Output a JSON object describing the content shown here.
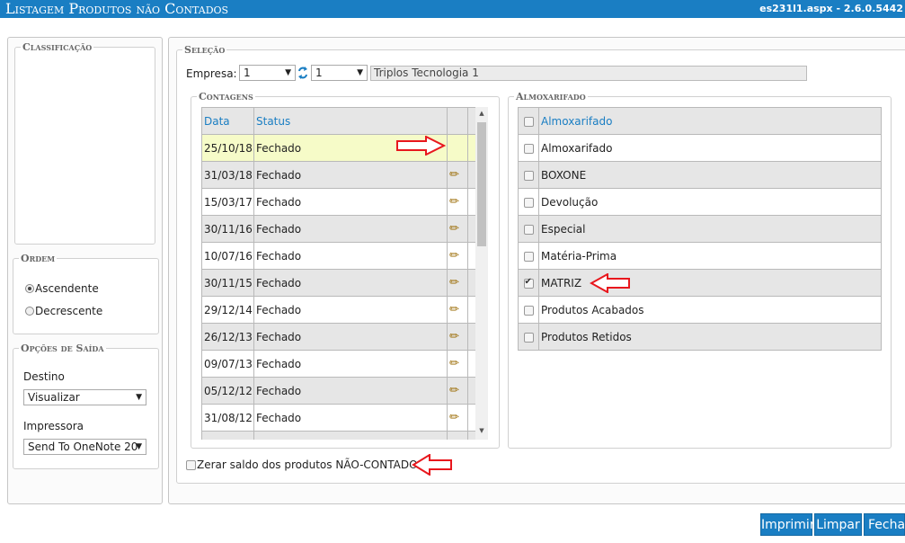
{
  "titlebar": {
    "title": "Listagem Produtos não Contados",
    "version": "es231l1.aspx - 2.6.0.5442"
  },
  "classificacao": {
    "legend": "Classificação"
  },
  "ordem": {
    "legend": "Ordem",
    "options": [
      "Ascendente",
      "Decrescente"
    ],
    "selected": "Ascendente"
  },
  "saida": {
    "legend": "Opções de Saída",
    "destino_label": "Destino",
    "destino_value": "Visualizar",
    "impressora_label": "Impressora",
    "impressora_value": "Send To OneNote 20"
  },
  "selecao": {
    "legend": "Seleção",
    "empresa_label": "Empresa:",
    "empresa_value": "1",
    "filial_value": "1",
    "empresa_nome": "Triplos Tecnologia 1"
  },
  "contagens": {
    "legend": "Contagens",
    "columns": [
      "Data",
      "Status"
    ],
    "rows": [
      {
        "data": "25/10/18",
        "status": "Fechado"
      },
      {
        "data": "31/03/18",
        "status": "Fechado"
      },
      {
        "data": "15/03/17",
        "status": "Fechado"
      },
      {
        "data": "30/11/16",
        "status": "Fechado"
      },
      {
        "data": "10/07/16",
        "status": "Fechado"
      },
      {
        "data": "30/11/15",
        "status": "Fechado"
      },
      {
        "data": "29/12/14",
        "status": "Fechado"
      },
      {
        "data": "26/12/13",
        "status": "Fechado"
      },
      {
        "data": "09/07/13",
        "status": "Fechado"
      },
      {
        "data": "05/12/12",
        "status": "Fechado"
      },
      {
        "data": "31/08/12",
        "status": "Fechado"
      }
    ]
  },
  "almoxarifado": {
    "legend": "Almoxarifado",
    "column": "Almoxarifado",
    "rows": [
      {
        "nome": "Almoxarifado",
        "checked": false
      },
      {
        "nome": "BOXONE",
        "checked": false
      },
      {
        "nome": "Devolução",
        "checked": false
      },
      {
        "nome": "Especial",
        "checked": false
      },
      {
        "nome": "Matéria-Prima",
        "checked": false
      },
      {
        "nome": "MATRIZ",
        "checked": true
      },
      {
        "nome": "Produtos Acabados",
        "checked": false
      },
      {
        "nome": "Produtos Retidos",
        "checked": false
      }
    ]
  },
  "zerar": {
    "label": "Zerar saldo dos produtos NÃO-CONTADOS?",
    "checked": false
  },
  "buttons": {
    "imprimir": "Imprimir",
    "limpar": "Limpar",
    "fechar": "Fecha"
  },
  "colors": {
    "accent": "#1a7ec3",
    "highlight_row": "#f6fbc8",
    "annotation": "#e8171d"
  }
}
